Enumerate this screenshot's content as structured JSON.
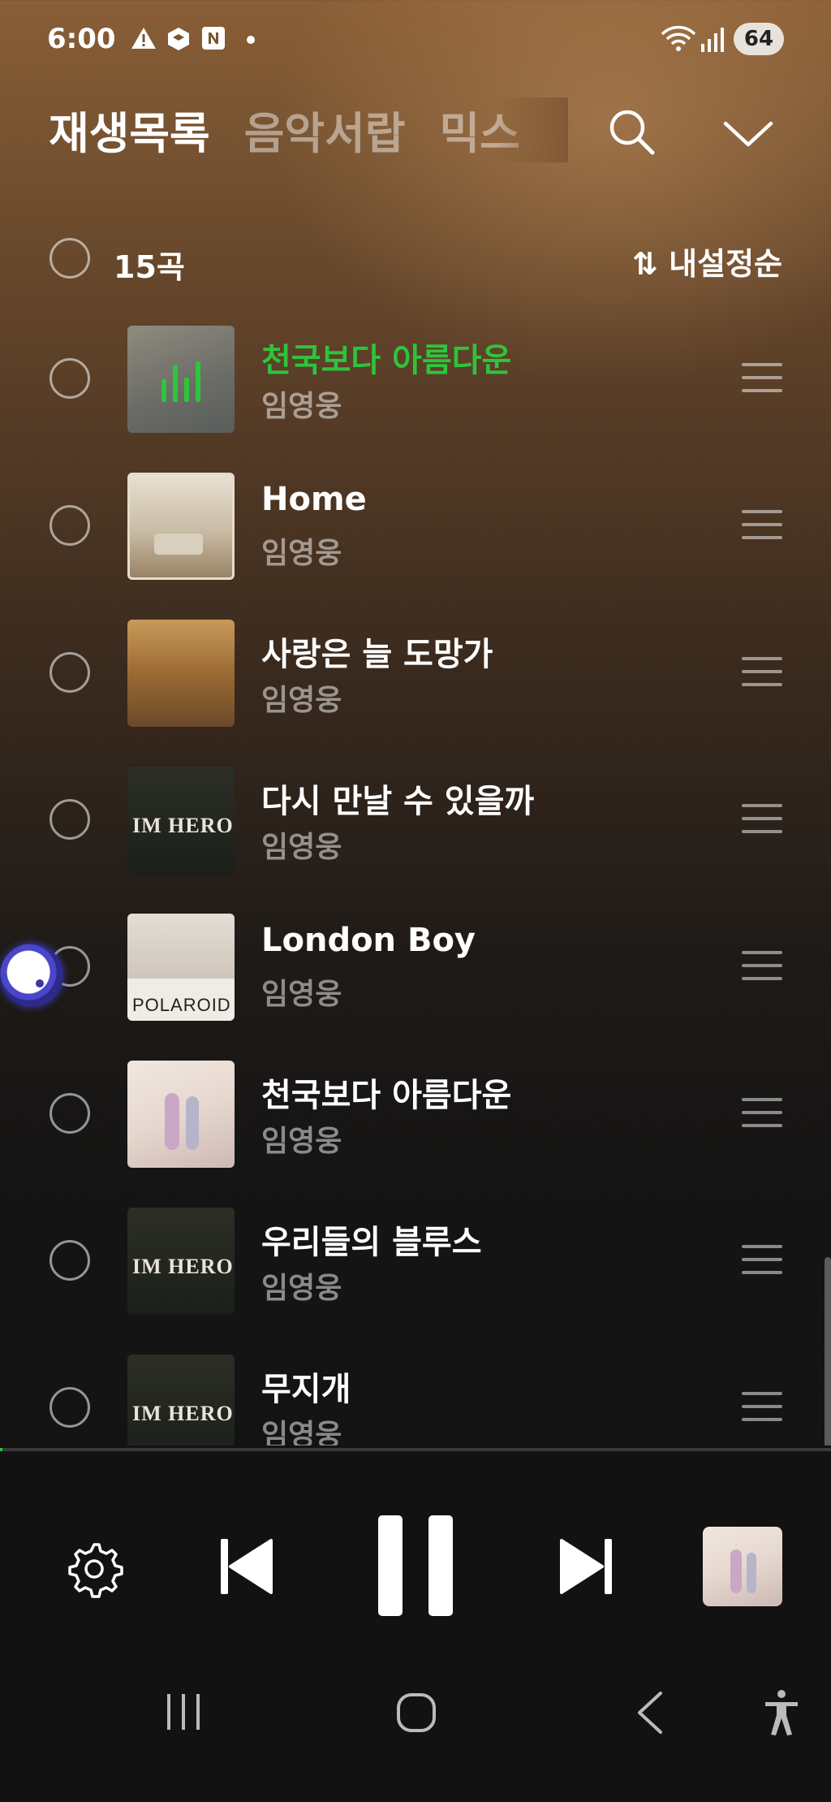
{
  "status_bar": {
    "time": "6:00",
    "battery": "64"
  },
  "header": {
    "tabs": [
      {
        "label": "재생목록",
        "active": true
      },
      {
        "label": "음악서랍",
        "active": false
      },
      {
        "label": "믹스",
        "active": false
      }
    ]
  },
  "list_header": {
    "count": "15곡",
    "sort_label": "⇅ 내설정순"
  },
  "songs": [
    {
      "title": "천국보다 아름다운",
      "artist": "임영웅",
      "playing": true
    },
    {
      "title": "Home",
      "artist": "임영웅",
      "playing": false
    },
    {
      "title": "사랑은 늘 도망가",
      "artist": "임영웅",
      "playing": false
    },
    {
      "title": "다시 만날 수 있을까",
      "artist": "임영웅",
      "playing": false,
      "art_text": "IM HERO"
    },
    {
      "title": "London Boy",
      "artist": "임영웅",
      "playing": false,
      "art_text": "POLAROID"
    },
    {
      "title": "천국보다 아름다운",
      "artist": "임영웅",
      "playing": false
    },
    {
      "title": "우리들의 블루스",
      "artist": "임영웅",
      "playing": false,
      "art_text": "IM HERO"
    },
    {
      "title": "무지개",
      "artist": "임영웅",
      "playing": false,
      "art_text": "IM HERO"
    }
  ],
  "player": {
    "progress_fraction": 0.003,
    "state": "playing"
  },
  "colors": {
    "accent_green": "#2ec43c",
    "background_top": "#8a5e36",
    "background_bottom": "#121212"
  },
  "icons": [
    "warning-icon",
    "box-icon",
    "n-notification-icon",
    "wifi-icon",
    "signal-icon",
    "search-icon",
    "chevron-down-icon",
    "drag-handle-icon",
    "settings-icon",
    "previous-icon",
    "pause-icon",
    "next-icon",
    "recents-icon",
    "home-icon",
    "back-icon",
    "accessibility-icon"
  ]
}
